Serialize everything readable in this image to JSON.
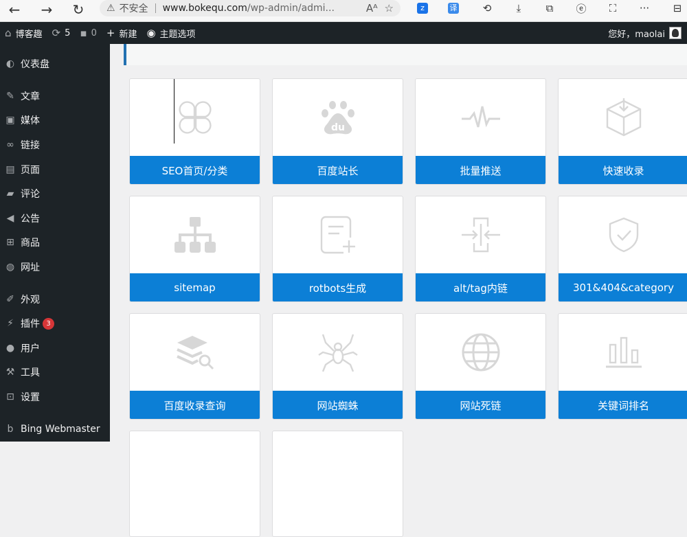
{
  "browser": {
    "security_label": "不安全",
    "url_main": "www.bokequ.com",
    "url_rest": "/wp-admin/admi...",
    "url_read_aloud_icon": "A⁵"
  },
  "adminbar": {
    "site_name": "博客趣",
    "updates_count": "5",
    "comments_count": "0",
    "new_label": "新建",
    "theme_options_label": "主题选项",
    "greeting": "您好，maolai"
  },
  "sidebar": {
    "items": [
      {
        "label": "仪表盘",
        "icon": "dashboard-icon"
      },
      {
        "label": "文章",
        "icon": "pin-icon"
      },
      {
        "label": "媒体",
        "icon": "media-icon"
      },
      {
        "label": "链接",
        "icon": "link-icon"
      },
      {
        "label": "页面",
        "icon": "page-icon"
      },
      {
        "label": "评论",
        "icon": "comment-icon"
      },
      {
        "label": "公告",
        "icon": "megaphone-icon"
      },
      {
        "label": "商品",
        "icon": "cart-icon"
      },
      {
        "label": "网址",
        "icon": "globe-icon"
      },
      {
        "label": "外观",
        "icon": "brush-icon"
      },
      {
        "label": "插件",
        "icon": "plugin-icon",
        "badge": "3"
      },
      {
        "label": "用户",
        "icon": "user-icon"
      },
      {
        "label": "工具",
        "icon": "wrench-icon"
      },
      {
        "label": "设置",
        "icon": "settings-icon"
      },
      {
        "label": "Bing Webmaster",
        "icon": "bing-icon"
      }
    ]
  },
  "cards": [
    {
      "label": "SEO首页/分类",
      "icon": "clover-icon"
    },
    {
      "label": "百度站长",
      "icon": "baidu-paw-icon"
    },
    {
      "label": "批量推送",
      "icon": "pulse-icon"
    },
    {
      "label": "快速收录",
      "icon": "box-download-icon"
    },
    {
      "label": "sitemap",
      "icon": "sitemap-icon"
    },
    {
      "label": "rotbots生成",
      "icon": "file-add-icon"
    },
    {
      "label": "alt/tag内链",
      "icon": "merge-arrows-icon"
    },
    {
      "label": "301&404&category",
      "icon": "shield-check-icon"
    },
    {
      "label": "百度收录查询",
      "icon": "layers-search-icon"
    },
    {
      "label": "网站蜘蛛",
      "icon": "spider-icon"
    },
    {
      "label": "网站死链",
      "icon": "globe-icon"
    },
    {
      "label": "关键词排名",
      "icon": "bar-chart-icon"
    }
  ]
}
